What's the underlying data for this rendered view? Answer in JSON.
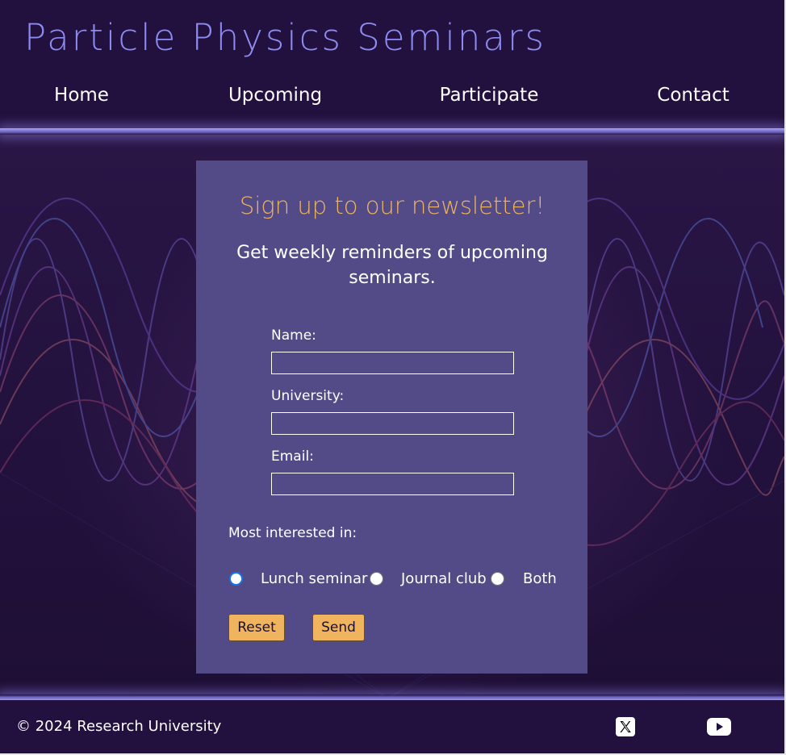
{
  "site": {
    "title": "Particle Physics Seminars"
  },
  "nav": {
    "items": [
      {
        "label": "Home"
      },
      {
        "label": "Upcoming"
      },
      {
        "label": "Participate"
      },
      {
        "label": "Contact"
      }
    ]
  },
  "newsletter": {
    "heading": "Sign up to our newsletter!",
    "subheading": "Get weekly reminders of upcoming seminars.",
    "fields": {
      "name": {
        "label": "Name:",
        "value": ""
      },
      "university": {
        "label": "University:",
        "value": ""
      },
      "email": {
        "label": "Email:",
        "value": ""
      }
    },
    "interest": {
      "label": "Most interested in:",
      "options": [
        {
          "label": "Lunch seminar",
          "selected": true
        },
        {
          "label": "Journal club",
          "selected": false
        },
        {
          "label": "Both",
          "selected": false
        }
      ]
    },
    "buttons": {
      "reset": "Reset",
      "send": "Send"
    }
  },
  "footer": {
    "copyright": "© 2024 Research University",
    "social": [
      {
        "icon": "x-twitter-icon"
      },
      {
        "icon": "youtube-icon"
      }
    ]
  },
  "colors": {
    "header_bg": "#22103e",
    "title": "#8d8cf2",
    "card_bg": "#524b87",
    "accent": "#f0b35e",
    "radio_selected": "#1a73e8"
  }
}
